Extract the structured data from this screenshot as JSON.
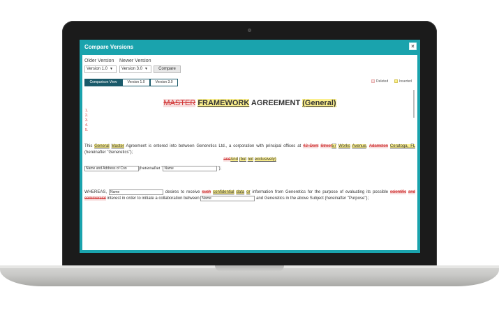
{
  "dialog": {
    "title": "Compare Versions",
    "close_icon": "×"
  },
  "controls": {
    "older_label": "Older Version",
    "newer_label": "Newer Version",
    "older_value": "Version 1.0",
    "newer_value": "Version 3.0",
    "compare_label": "Compare"
  },
  "tabs": [
    {
      "label": "Comparison View",
      "active": true
    },
    {
      "label": "Version 1.0",
      "active": false
    },
    {
      "label": "Version 3.0",
      "active": false
    }
  ],
  "legend": {
    "deleted": "Deleted",
    "inserted": "Inserted",
    "deleted_color": "#f7dede",
    "inserted_color": "#fbef8c"
  },
  "document": {
    "title_deleted": "MASTER",
    "title_inserted": "FRAMEWORK",
    "title_plain": "AGREEMENT",
    "title_general": "(General)",
    "numbers": [
      "1.",
      "2.",
      "3.",
      "4.",
      "5."
    ],
    "p1": {
      "a": "This ",
      "b": "General",
      "c": " ",
      "d": "Master",
      "e": " Agreement is entered into between Generetics Ltd., a corporation with principal offices at ",
      "f": "42 Dent",
      "g": " ",
      "h": "Street",
      "i": "57",
      "j": " ",
      "k": "Works",
      "l": " ",
      "m": "Avenue",
      "n": ", ",
      "o": "Adamston",
      "p": "Ceratoga, FL",
      "q": " (hereinafter \"Generetics\");"
    },
    "p2": {
      "a": "and",
      "b": "And",
      "c": " ",
      "d": "(but",
      "e": " ",
      "f": "not",
      "g": " ",
      "h": "exclusively)"
    },
    "p3": {
      "field1": "Name and Address of Con",
      "a": "(hereinafter \"",
      "field2": "Name",
      "b": "\");"
    },
    "p4": {
      "a": "WHEREAS, ",
      "field1": "Name",
      "b": " desires to receive ",
      "c": "such",
      "d": " ",
      "e": "confidential",
      "f": " ",
      "g": "data",
      "h": " ",
      "i": "or",
      "j": " information from Generetics for the purpose of evaluating its possible ",
      "k": "scientific",
      "l": " ",
      "m": "and",
      "n": " ",
      "o": "commercial",
      "p": " interest in order to initiate a collaboration between ",
      "field2": "Name",
      "q": " and Generetics in the above Subject (hereinafter \"Purpose\");"
    }
  }
}
